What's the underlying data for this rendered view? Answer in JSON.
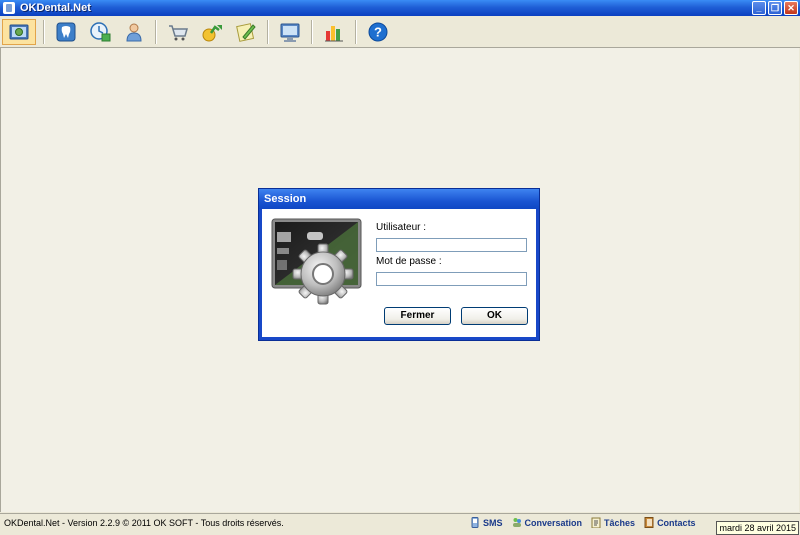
{
  "window": {
    "title": "OKDental.Net",
    "min": "_",
    "max": "❐",
    "close": "✕"
  },
  "dialog": {
    "title": "Session",
    "user_label": "Utilisateur :",
    "user_value": "",
    "password_label": "Mot de passe :",
    "password_value": "",
    "close_button": "Fermer",
    "ok_button": "OK"
  },
  "status": {
    "text": "OKDental.Net - Version 2.2.9 © 2011 OK SOFT - Tous droits réservés.",
    "sms": "SMS",
    "conversation": "Conversation",
    "tasks": "Tâches",
    "contacts": "Contacts",
    "date": "mardi 28 avril 2015"
  },
  "toolbar_icons": [
    "session-icon",
    "tooth-icon",
    "agenda-clock-icon",
    "patient-icon",
    "cart-icon",
    "finance-icon",
    "notes-icon",
    "settings-icon",
    "chart-icon",
    "help-icon"
  ]
}
